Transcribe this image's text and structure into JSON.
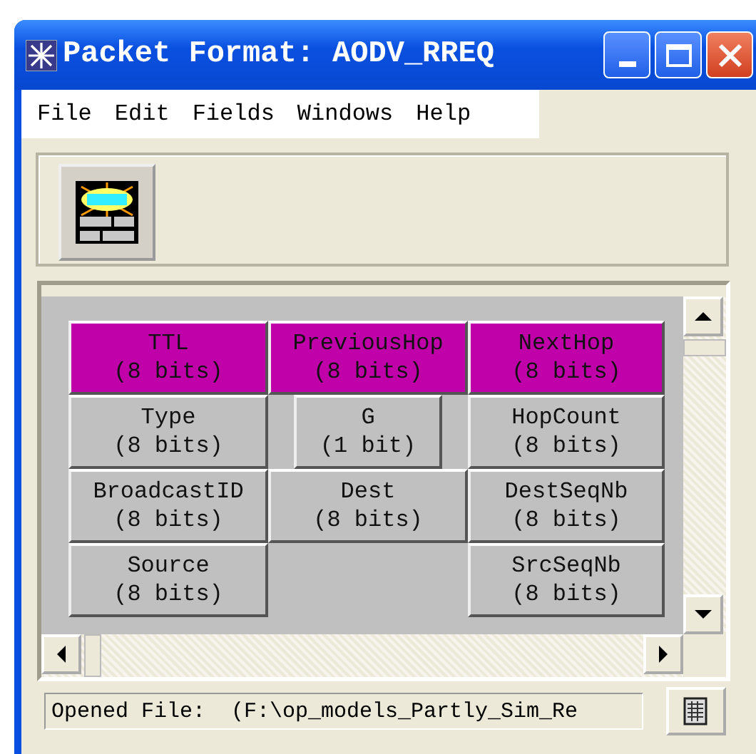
{
  "window": {
    "title": "Packet Format: AODV_RREQ"
  },
  "menu": [
    "File",
    "Edit",
    "Fields",
    "Windows",
    "Help"
  ],
  "rows": [
    [
      {
        "kind": "full",
        "name": "TTL",
        "size": "(8 bits)",
        "color": "#c000a8"
      },
      {
        "kind": "full",
        "name": "PreviousHop",
        "size": "(8 bits)",
        "color": "#c000a8"
      },
      {
        "kind": "full",
        "name": "NextHop",
        "size": "(8 bits)",
        "color": "#c000a8"
      }
    ],
    [
      {
        "kind": "full",
        "name": "Type",
        "size": "(8 bits)",
        "color": "#c0c0c0"
      },
      {
        "kind": "narrow",
        "name": "G",
        "size": "(1 bit)",
        "color": "#c0c0c0"
      },
      {
        "kind": "full",
        "name": "HopCount",
        "size": "(8 bits)",
        "color": "#c0c0c0"
      }
    ],
    [
      {
        "kind": "full",
        "name": "BroadcastID",
        "size": "(8 bits)",
        "color": "#c0c0c0"
      },
      {
        "kind": "full",
        "name": "Dest",
        "size": "(8 bits)",
        "color": "#c0c0c0"
      },
      {
        "kind": "full",
        "name": "DestSeqNb",
        "size": "(8 bits)",
        "color": "#c0c0c0"
      }
    ],
    [
      {
        "kind": "full",
        "name": "Source",
        "size": "(8 bits)",
        "color": "#c0c0c0"
      },
      {
        "kind": "empty"
      },
      {
        "kind": "full",
        "name": "SrcSeqNb",
        "size": "(8 bits)",
        "color": "#c0c0c0"
      }
    ]
  ],
  "status_bar": {
    "text": "Opened File:  (F:\\op_models_Partly_Sim_Re"
  }
}
